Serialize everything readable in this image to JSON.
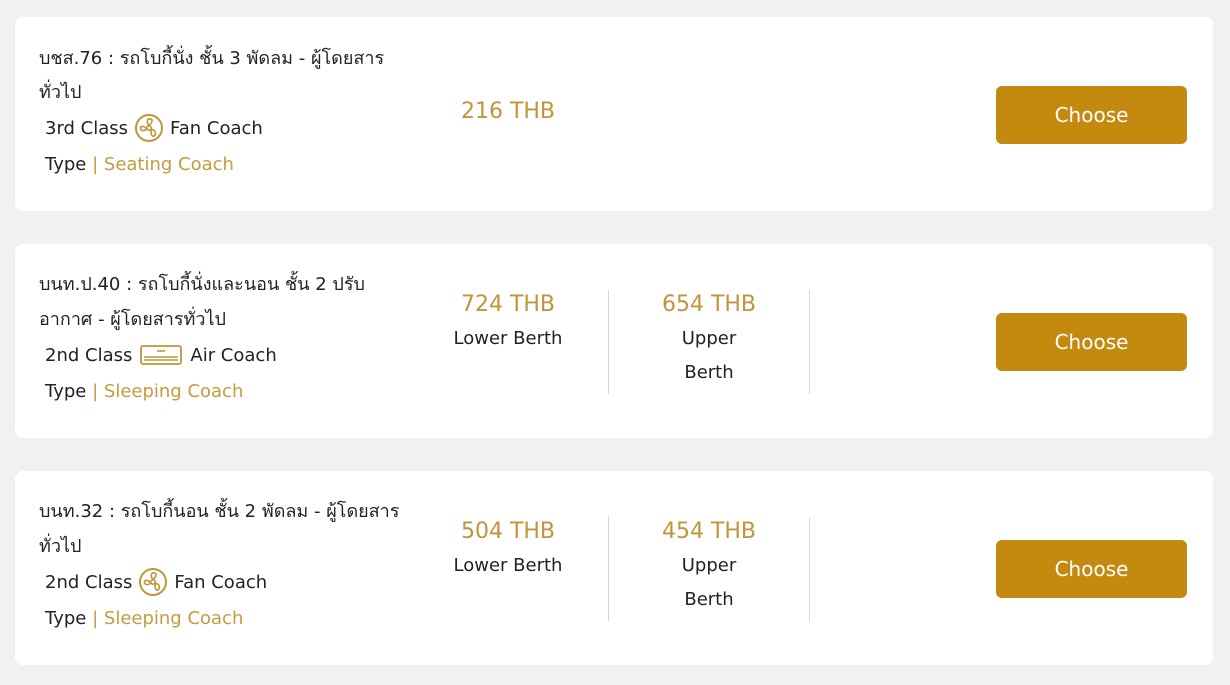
{
  "colors": {
    "accent": "#c29439",
    "button": "#c48a10",
    "background": "#f1f1f1",
    "card": "#ffffff"
  },
  "trains": [
    {
      "name": "บชส.76 : รถโบกี้นั่ง ชั้น 3 พัดลม - ผู้โดยสาร ทั่วไป",
      "class_label": "3rd Class",
      "coach_icon": "fan-icon",
      "coach_type": "Fan Coach",
      "type_label": "Type",
      "type_separator": "|",
      "type_value": "Seating Coach",
      "prices": [
        {
          "price": "216 THB",
          "berth": ""
        }
      ],
      "choose_label": "Choose"
    },
    {
      "name": "บนท.ป.40 : รถโบกี้นั่งและนอน ชั้น 2 ปรับ อากาศ - ผู้โดยสารทั่วไป",
      "class_label": "2nd Class",
      "coach_icon": "air-conditioner-icon",
      "coach_type": "Air Coach",
      "type_label": "Type",
      "type_separator": "|",
      "type_value": "Sleeping Coach",
      "prices": [
        {
          "price": "724 THB",
          "berth": "Lower Berth"
        },
        {
          "price": "654 THB",
          "berth": "Upper Berth"
        }
      ],
      "choose_label": "Choose"
    },
    {
      "name": "บนท.32 : รถโบกี้นอน ชั้น 2 พัดลม - ผู้โดยสาร ทั่วไป",
      "class_label": "2nd Class",
      "coach_icon": "fan-icon",
      "coach_type": "Fan Coach",
      "type_label": "Type",
      "type_separator": "|",
      "type_value": "Sleeping Coach",
      "prices": [
        {
          "price": "504 THB",
          "berth": "Lower Berth"
        },
        {
          "price": "454 THB",
          "berth": "Upper Berth"
        }
      ],
      "choose_label": "Choose"
    }
  ]
}
